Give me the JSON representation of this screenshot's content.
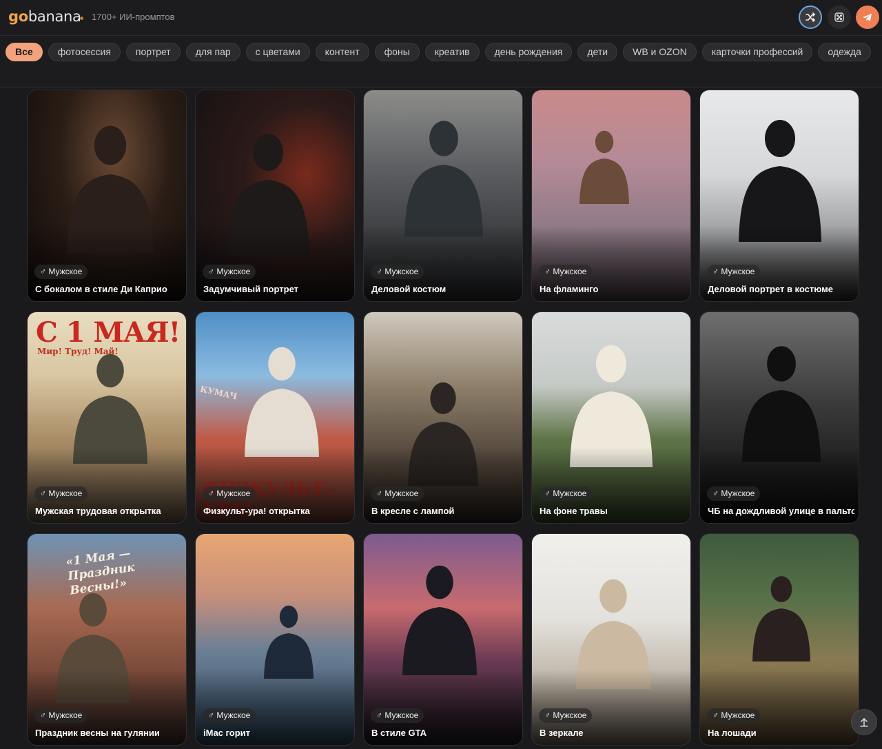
{
  "header": {
    "logo_go": "go",
    "logo_banana": "banana",
    "prompt_count": "1700+ ИИ-промптов",
    "icons": [
      "shuffle-icon",
      "dice-icon",
      "telegram-icon"
    ],
    "accent": "#f0a24a"
  },
  "tags": {
    "active_color": "#f2a27c",
    "items": [
      "Все",
      "фотосессия",
      "портрет",
      "для пар",
      "с цветами",
      "контент",
      "фоны",
      "креатив",
      "день рождения",
      "дети",
      "WB и OZON",
      "карточки профессий",
      "одежда"
    ]
  },
  "cards": [
    {
      "gender": "♂ Мужское",
      "title": "С бокалом в стиле Ди Каприо"
    },
    {
      "gender": "♂ Мужское",
      "title": "Задумчивый портрет"
    },
    {
      "gender": "♂ Мужское",
      "title": "Деловой костюм"
    },
    {
      "gender": "♂ Мужское",
      "title": "На фламинго"
    },
    {
      "gender": "♂ Мужское",
      "title": "Деловой портрет в костюме"
    },
    {
      "gender": "♂ Мужское",
      "title": "Мужская трудовая открытка"
    },
    {
      "gender": "♂ Мужское",
      "title": "Физкульт-ура! открытка"
    },
    {
      "gender": "♂ Мужское",
      "title": "В кресле с лампой"
    },
    {
      "gender": "♂ Мужское",
      "title": "На фоне травы"
    },
    {
      "gender": "♂ Мужское",
      "title": "ЧБ на дождливой улице в пальто"
    },
    {
      "gender": "♂ Мужское",
      "title": "Праздник весны на гулянии"
    },
    {
      "gender": "♂ Мужское",
      "title": "iMac горит"
    },
    {
      "gender": "♂ Мужское",
      "title": "В стиле GTA"
    },
    {
      "gender": "♂ Мужское",
      "title": "В зеркале"
    },
    {
      "gender": "♂ Мужское",
      "title": "На лошади"
    }
  ],
  "poster_text": {
    "may_day": "С 1 МАЯ!",
    "may_day_sub": "Мир! Труд! Май!",
    "sport": "ФИЗКУЛЬТ-УРА!",
    "sport_banner": "КУМАЧ",
    "spring": "«1 Мая — Праздник Весны!»"
  }
}
